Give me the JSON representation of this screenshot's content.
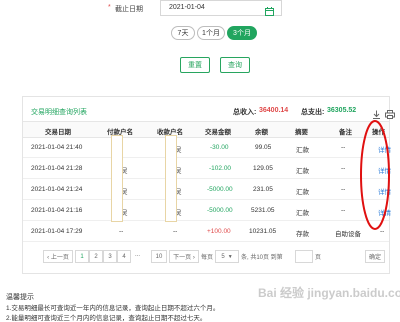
{
  "filter": {
    "required_mark": "*",
    "date_label": "截止日期",
    "date_value": "2021-01-04",
    "ranges": [
      "7天",
      "1个月",
      "3个月"
    ],
    "active_range_index": 2,
    "reset_label": "重置",
    "query_label": "查询"
  },
  "panel": {
    "title": "交易明细查询列表",
    "total_in_label": "总收入:",
    "total_in_value": "36400.14",
    "total_out_label": "总支出:",
    "total_out_value": "36305.52",
    "columns": [
      "交易日期",
      "付款户名",
      "收款户名",
      "交易金额",
      "余额",
      "摘要",
      "备注",
      "操作"
    ],
    "rows": [
      {
        "date": "2021-01-04 21:40",
        "payer": "",
        "payee": "炅",
        "amount": "-30.00",
        "balance": "99.05",
        "summary": "汇款",
        "remark": "--",
        "action": "详情"
      },
      {
        "date": "2021-01-04 21:28",
        "payer": "炅",
        "payee": "炅",
        "amount": "-102.00",
        "balance": "129.05",
        "summary": "汇款",
        "remark": "--",
        "action": "详情"
      },
      {
        "date": "2021-01-04 21:24",
        "payer": "炅",
        "payee": "炅",
        "amount": "-5000.00",
        "balance": "231.05",
        "summary": "汇款",
        "remark": "--",
        "action": "详情"
      },
      {
        "date": "2021-01-04 21:16",
        "payer": "炅",
        "payee": "炅",
        "amount": "-5000.00",
        "balance": "5231.05",
        "summary": "汇款",
        "remark": "--",
        "action": "详情"
      },
      {
        "date": "2021-01-04 17:29",
        "payer": "--",
        "payee": "--",
        "amount": "+100.00",
        "balance": "10231.05",
        "summary": "存款",
        "remark": "自助设备",
        "action": "--"
      }
    ]
  },
  "pager": {
    "prev": "‹ 上一页",
    "pages": [
      "1",
      "2",
      "3",
      "4"
    ],
    "ellipsis": "...",
    "last_page": "10",
    "next": "下一页 ›",
    "per_page_label": "每页",
    "per_page_value": "5",
    "total_text": "条, 共10页 到第",
    "goto_suffix": "页",
    "confirm": "确定"
  },
  "tips": {
    "heading": "温馨提示",
    "line1": "1.交易明细最长可查询近一年内的信息记录，查询起止日期不超过六个月。",
    "line2": "2.能量明细可查询近三个月内的信息记录，查询起止日期不超过七天。"
  },
  "watermark": "Bai 经验 jingyan.baidu.com",
  "colors": {
    "accent": "#21a55f",
    "negative": "#e04a4a",
    "link": "#2a7bd8",
    "annotation": "#e01010"
  },
  "icons": [
    "calendar-icon",
    "download-icon",
    "print-icon",
    "clock-icon"
  ]
}
